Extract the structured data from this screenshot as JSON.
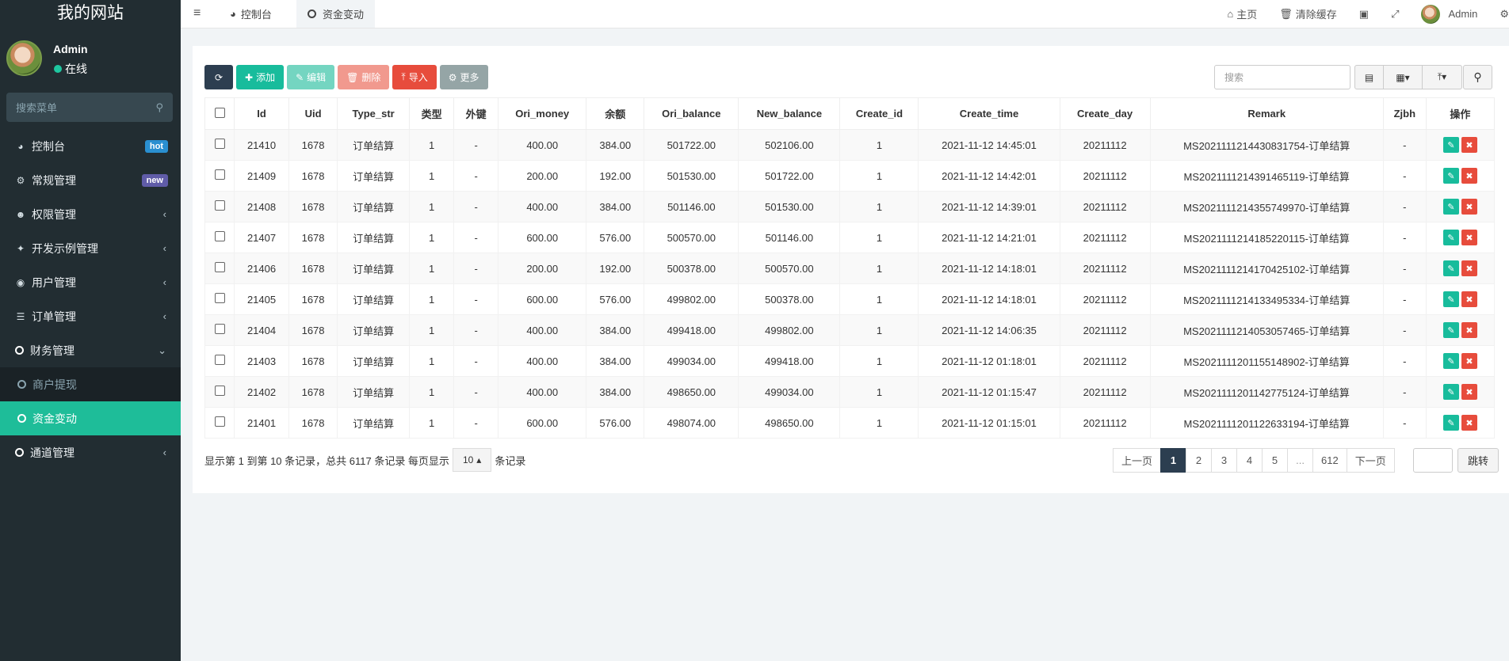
{
  "site_title": "我的网站",
  "user": {
    "name": "Admin",
    "status": "在线"
  },
  "sidebar": {
    "search_placeholder": "搜索菜单",
    "items": [
      {
        "label": "控制台",
        "icon": "dashboard-icon",
        "badge": "hot"
      },
      {
        "label": "常规管理",
        "icon": "cogs-icon",
        "badge": "new"
      },
      {
        "label": "权限管理",
        "icon": "group-icon",
        "arrow": "‹"
      },
      {
        "label": "开发示例管理",
        "icon": "magic-icon",
        "arrow": "‹"
      },
      {
        "label": "用户管理",
        "icon": "user-circle-icon",
        "arrow": "‹"
      },
      {
        "label": "订单管理",
        "icon": "list-icon",
        "arrow": "‹"
      },
      {
        "label": "财务管理",
        "icon": "circle-icon",
        "arrow": "⌄"
      }
    ],
    "sub_items": [
      {
        "label": "商户提现"
      },
      {
        "label": "资金变动"
      }
    ],
    "last_item": {
      "label": "通道管理",
      "arrow": "‹"
    }
  },
  "topbar": {
    "tabs": [
      {
        "label": "控制台"
      },
      {
        "label": "资金变动"
      }
    ],
    "right": {
      "home": "主页",
      "clear_cache": "清除缓存",
      "user": "Admin"
    }
  },
  "toolbar": {
    "add": "添加",
    "edit": "编辑",
    "delete": "删除",
    "import": "导入",
    "more": "更多",
    "search_placeholder": "搜索"
  },
  "table": {
    "headers": [
      "Id",
      "Uid",
      "Type_str",
      "类型",
      "外键",
      "Ori_money",
      "余额",
      "Ori_balance",
      "New_balance",
      "Create_id",
      "Create_time",
      "Create_day",
      "Remark",
      "Zjbh",
      "操作"
    ],
    "rows": [
      [
        "21410",
        "1678",
        "订单结算",
        "1",
        "-",
        "400.00",
        "384.00",
        "501722.00",
        "502106.00",
        "1",
        "2021-11-12 14:45:01",
        "20211112",
        "MS2021111214430831754-订单结算",
        "-"
      ],
      [
        "21409",
        "1678",
        "订单结算",
        "1",
        "-",
        "200.00",
        "192.00",
        "501530.00",
        "501722.00",
        "1",
        "2021-11-12 14:42:01",
        "20211112",
        "MS2021111214391465119-订单结算",
        "-"
      ],
      [
        "21408",
        "1678",
        "订单结算",
        "1",
        "-",
        "400.00",
        "384.00",
        "501146.00",
        "501530.00",
        "1",
        "2021-11-12 14:39:01",
        "20211112",
        "MS2021111214355749970-订单结算",
        "-"
      ],
      [
        "21407",
        "1678",
        "订单结算",
        "1",
        "-",
        "600.00",
        "576.00",
        "500570.00",
        "501146.00",
        "1",
        "2021-11-12 14:21:01",
        "20211112",
        "MS2021111214185220115-订单结算",
        "-"
      ],
      [
        "21406",
        "1678",
        "订单结算",
        "1",
        "-",
        "200.00",
        "192.00",
        "500378.00",
        "500570.00",
        "1",
        "2021-11-12 14:18:01",
        "20211112",
        "MS2021111214170425102-订单结算",
        "-"
      ],
      [
        "21405",
        "1678",
        "订单结算",
        "1",
        "-",
        "600.00",
        "576.00",
        "499802.00",
        "500378.00",
        "1",
        "2021-11-12 14:18:01",
        "20211112",
        "MS2021111214133495334-订单结算",
        "-"
      ],
      [
        "21404",
        "1678",
        "订单结算",
        "1",
        "-",
        "400.00",
        "384.00",
        "499418.00",
        "499802.00",
        "1",
        "2021-11-12 14:06:35",
        "20211112",
        "MS2021111214053057465-订单结算",
        "-"
      ],
      [
        "21403",
        "1678",
        "订单结算",
        "1",
        "-",
        "400.00",
        "384.00",
        "499034.00",
        "499418.00",
        "1",
        "2021-11-12 01:18:01",
        "20211112",
        "MS2021111201155148902-订单结算",
        "-"
      ],
      [
        "21402",
        "1678",
        "订单结算",
        "1",
        "-",
        "400.00",
        "384.00",
        "498650.00",
        "499034.00",
        "1",
        "2021-11-12 01:15:47",
        "20211112",
        "MS2021111201142775124-订单结算",
        "-"
      ],
      [
        "21401",
        "1678",
        "订单结算",
        "1",
        "-",
        "600.00",
        "576.00",
        "498074.00",
        "498650.00",
        "1",
        "2021-11-12 01:15:01",
        "20211112",
        "MS2021111201122633194-订单结算",
        "-"
      ]
    ]
  },
  "footer": {
    "info": "显示第 1 到第 10 条记录，总共 6117 条记录 每页显示",
    "page_size": "10",
    "suffix": "条记录",
    "pages": [
      "上一页",
      "1",
      "2",
      "3",
      "4",
      "5",
      "...",
      "612",
      "下一页"
    ],
    "active_page": "1",
    "jump": "跳转"
  },
  "colors": {
    "sidebar_bg": "#222d32",
    "accent": "#18bc9c",
    "danger": "#e74c3c",
    "primary_dark": "#2c3e50"
  }
}
